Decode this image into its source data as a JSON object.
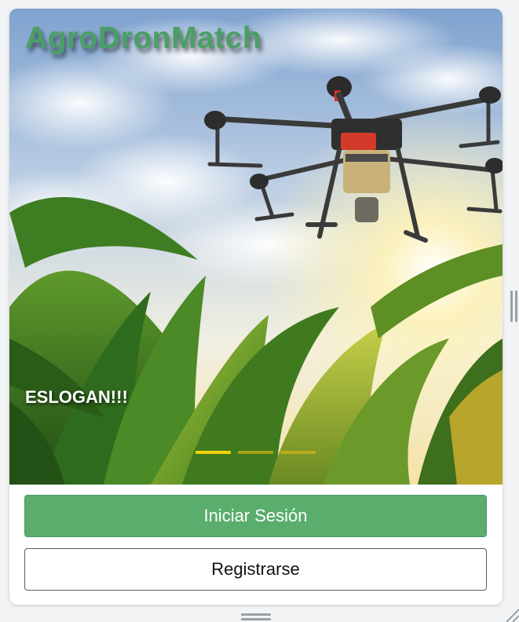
{
  "app": {
    "brand_name": "AgroDronMatch",
    "brand_color": "#4a9f66"
  },
  "carousel": {
    "slogan": "ESLOGAN!!!",
    "slide_count": 3,
    "active_slide": 1,
    "indicator_color": "#f3d20a"
  },
  "actions": {
    "login_label": "Iniciar Sesión",
    "register_label": "Registrarse",
    "login_color": "#5aad6c"
  }
}
